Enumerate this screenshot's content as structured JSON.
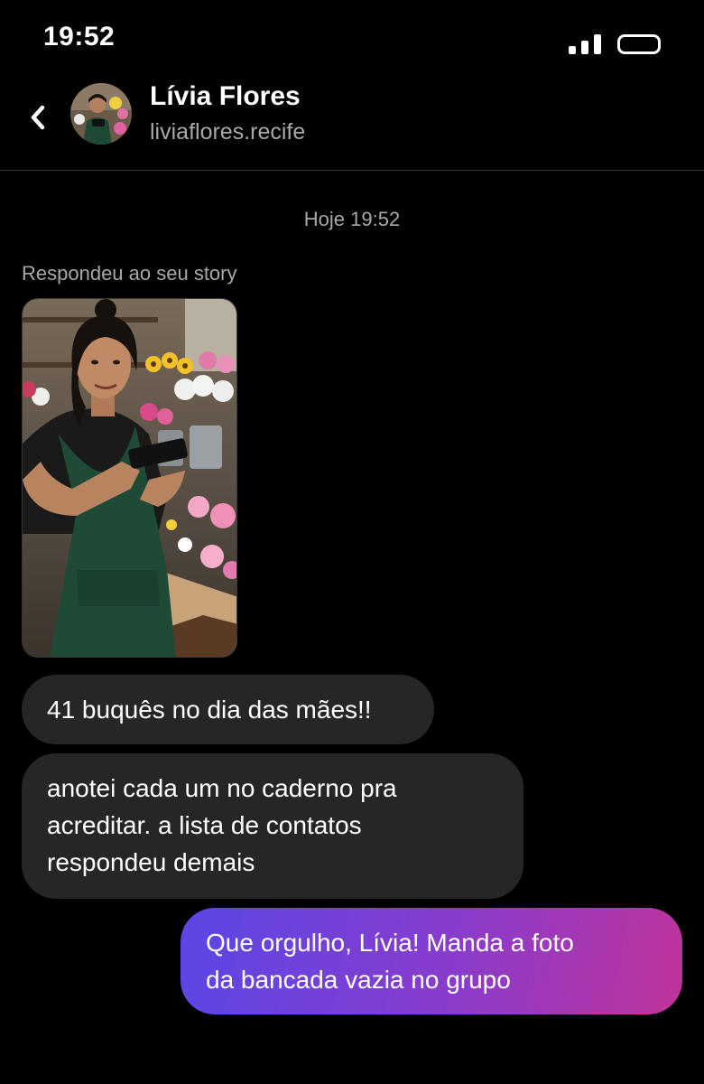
{
  "status_bar": {
    "time": "19:52",
    "signal_icon": "signal-bars-icon",
    "battery_icon": "battery-icon"
  },
  "header": {
    "back_icon": "chevron-left-icon",
    "name": "Lívia Flores",
    "handle": "liviaflores.recife"
  },
  "conversation": {
    "timestamp": "Hoje 19:52",
    "story_reply_label": "Respondeu ao seu story",
    "messages": [
      {
        "sender": "contact",
        "text": "41 buquês no dia das mães!!"
      },
      {
        "sender": "contact",
        "text": "anotei cada um no caderno pra\nacreditar. a lista de contatos\nrespondeu demais"
      },
      {
        "sender": "me",
        "text": "Que orgulho, Lívia! Manda a foto\nda bancada vazia no grupo"
      }
    ]
  },
  "colors": {
    "background": "#000000",
    "incoming_bubble": "#262626",
    "outgoing_gradient_start": "#5a46e6",
    "outgoing_gradient_end": "#c0339a",
    "secondary_text": "#a8a8a8",
    "apron_green": "#1f4a35"
  }
}
